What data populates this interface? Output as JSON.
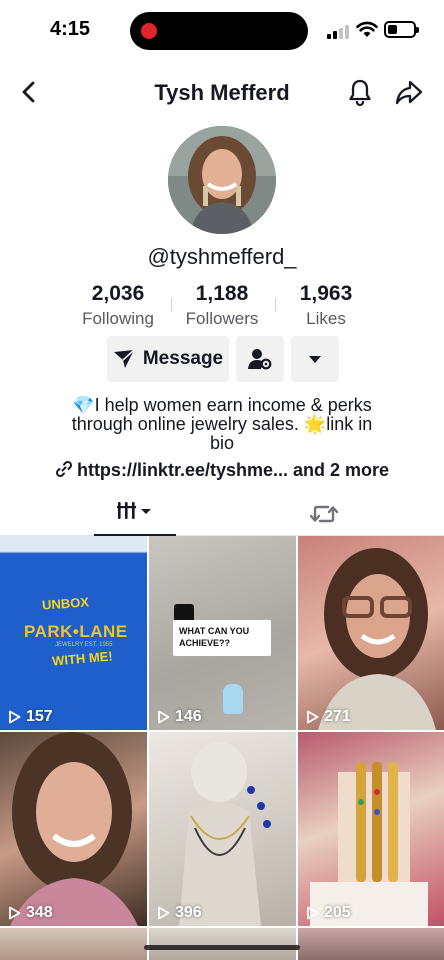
{
  "status_bar": {
    "time": "4:15"
  },
  "header": {
    "title": "Tysh Mefferd"
  },
  "profile": {
    "username": "@tyshmefferd_",
    "stats": [
      {
        "value": "2,036",
        "label": "Following"
      },
      {
        "value": "1,188",
        "label": "Followers"
      },
      {
        "value": "1,963",
        "label": "Likes"
      }
    ],
    "message_label": "Message",
    "bio_line1": "💎I help women earn income & perks",
    "bio_line2": "through online jewelry sales. 🌟link in",
    "bio_line3": "bio",
    "link_text": "https://linktr.ee/tyshme... and 2 more"
  },
  "videos": [
    {
      "views": "157",
      "overlay_unbox": "UNBOX",
      "overlay_brand": "PARK•LANE",
      "overlay_sub": "JEWELRY EST. 1955",
      "overlay_with": "WITH ME!"
    },
    {
      "views": "146",
      "overlay_text": "WHAT CAN YOU ACHIEVE??"
    },
    {
      "views": "271"
    },
    {
      "views": "348"
    },
    {
      "views": "396"
    },
    {
      "views": "205"
    }
  ]
}
